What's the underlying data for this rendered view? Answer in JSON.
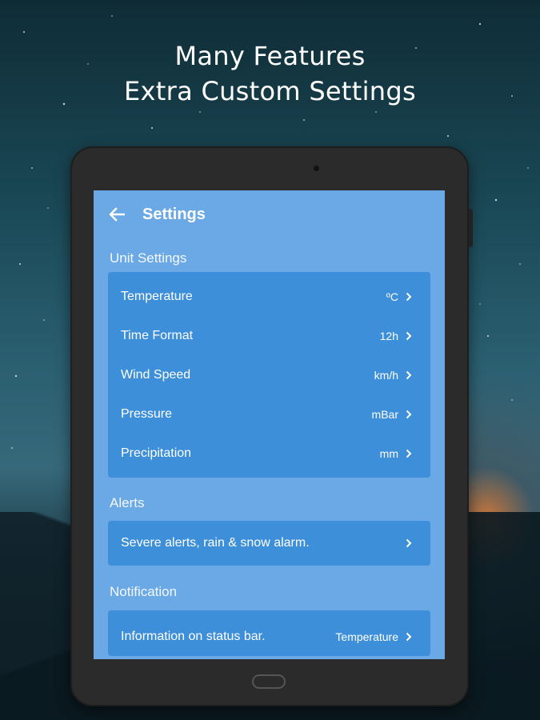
{
  "headline": {
    "line1": "Many Features",
    "line2": "Extra Custom Settings"
  },
  "appbar": {
    "back_icon": "arrow-left-icon",
    "title": "Settings"
  },
  "unit_settings": {
    "title": "Unit Settings",
    "rows": [
      {
        "label": "Temperature",
        "value": "ºC"
      },
      {
        "label": "Time Format",
        "value": "12h"
      },
      {
        "label": "Wind Speed",
        "value": "km/h"
      },
      {
        "label": "Pressure",
        "value": "mBar"
      },
      {
        "label": "Precipitation",
        "value": "mm"
      }
    ]
  },
  "alerts": {
    "title": "Alerts",
    "rows": [
      {
        "label": "Severe alerts, rain & snow alarm.",
        "value": ""
      }
    ]
  },
  "notification": {
    "title": "Notification",
    "rows": [
      {
        "label": "Information on status bar.",
        "value": "Temperature"
      }
    ]
  },
  "colors": {
    "screen_bg": "#6aa9e6",
    "card_bg": "#3d8fd9",
    "device": "#2b2b2b"
  }
}
